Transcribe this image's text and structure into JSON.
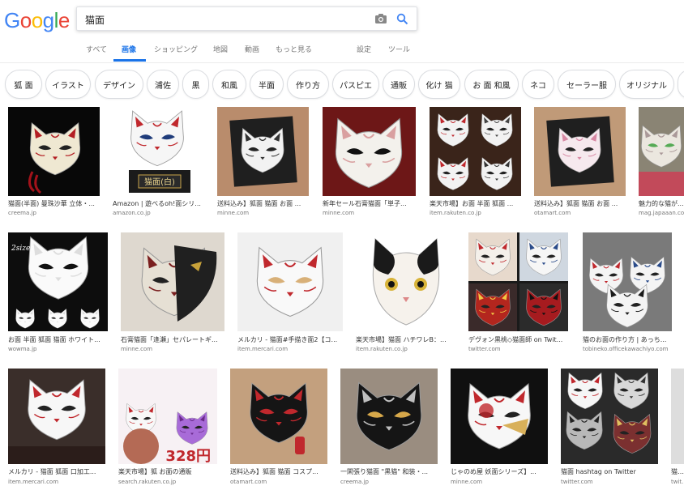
{
  "header": {
    "logo": [
      "G",
      "o",
      "o",
      "g",
      "l",
      "e"
    ],
    "logo_colors": [
      "#4285f4",
      "#ea4335",
      "#fbbc05",
      "#4285f4",
      "#34a853",
      "#ea4335"
    ],
    "search_query": "猫面"
  },
  "tabs": {
    "all": "すべて",
    "images": "画像",
    "shopping": "ショッピング",
    "maps": "地図",
    "videos": "動画",
    "more": "もっと見る",
    "settings": "設定",
    "tools": "ツール"
  },
  "chips": [
    "狐 面",
    "イラスト",
    "デザイン",
    "浦佐",
    "黒",
    "和風",
    "半面",
    "作り方",
    "パスピエ",
    "通販",
    "化け 猫",
    "お 面 和風",
    "ネコ",
    "セーラー服",
    "オリジナル"
  ],
  "results": [
    {
      "title": "猫面(半面) 曼珠沙華 立体・...",
      "site": "creema.jp"
    },
    {
      "title": "Amazon | 遊べるoh!面シリ...",
      "site": "amazon.co.jp"
    },
    {
      "title": "送料込み】狐面 猫面 お面 ...",
      "site": "minne.com"
    },
    {
      "title": "新年セール石膏猫面「単子...",
      "site": "minne.com"
    },
    {
      "title": "楽天市場】お面 半面 狐面 ...",
      "site": "item.rakuten.co.jp"
    },
    {
      "title": "送料込み】狐面 猫面 お面 ...",
      "site": "otamart.com"
    },
    {
      "title": "魅力的な猫が...",
      "site": "mag.japaaan.com"
    },
    {
      "title": "お面 半面 狐面 猫面 ホワイト...",
      "site": "wowma.jp"
    },
    {
      "title": "石膏猫面「逢瀬」セパレートギ...",
      "site": "minne.com"
    },
    {
      "title": "メルカリ - 猫面#手描き面2【コ...",
      "site": "item.mercari.com"
    },
    {
      "title": "楽天市場】猫面 ハチワレB：...",
      "site": "item.rakuten.co.jp"
    },
    {
      "title": "デヴォン黒桃◇猫面師 on Twit...",
      "site": "twitter.com"
    },
    {
      "title": "猫のお面の作り方 | あっち...",
      "site": "tobineko.officekawachiyo.com"
    },
    {
      "title": "メルカリ - 猫面 狐面 口加工...",
      "site": "item.mercari.com"
    },
    {
      "title": "楽天市場】狐 お面の通販",
      "site": "search.rakuten.co.jp"
    },
    {
      "title": "送料込み】狐面 猫面 コスプ...",
      "site": "otamart.com"
    },
    {
      "title": "一閑張り猫面 \"黒猫\" 和装・...",
      "site": "creema.jp"
    },
    {
      "title": "じゃのめ屋 妖面シリーズ】...",
      "site": "minne.com"
    },
    {
      "title": "猫面 hashtag on Twitter",
      "site": "twitter.com"
    },
    {
      "title": "猫面...",
      "site": "twit..."
    }
  ],
  "thumb_badges": {
    "amazon_label": "猫面(白)",
    "price": "328円",
    "twopc": "2sizes"
  },
  "colors": {
    "accent_blue": "#1a73e8",
    "mask_red": "#c0282d"
  }
}
